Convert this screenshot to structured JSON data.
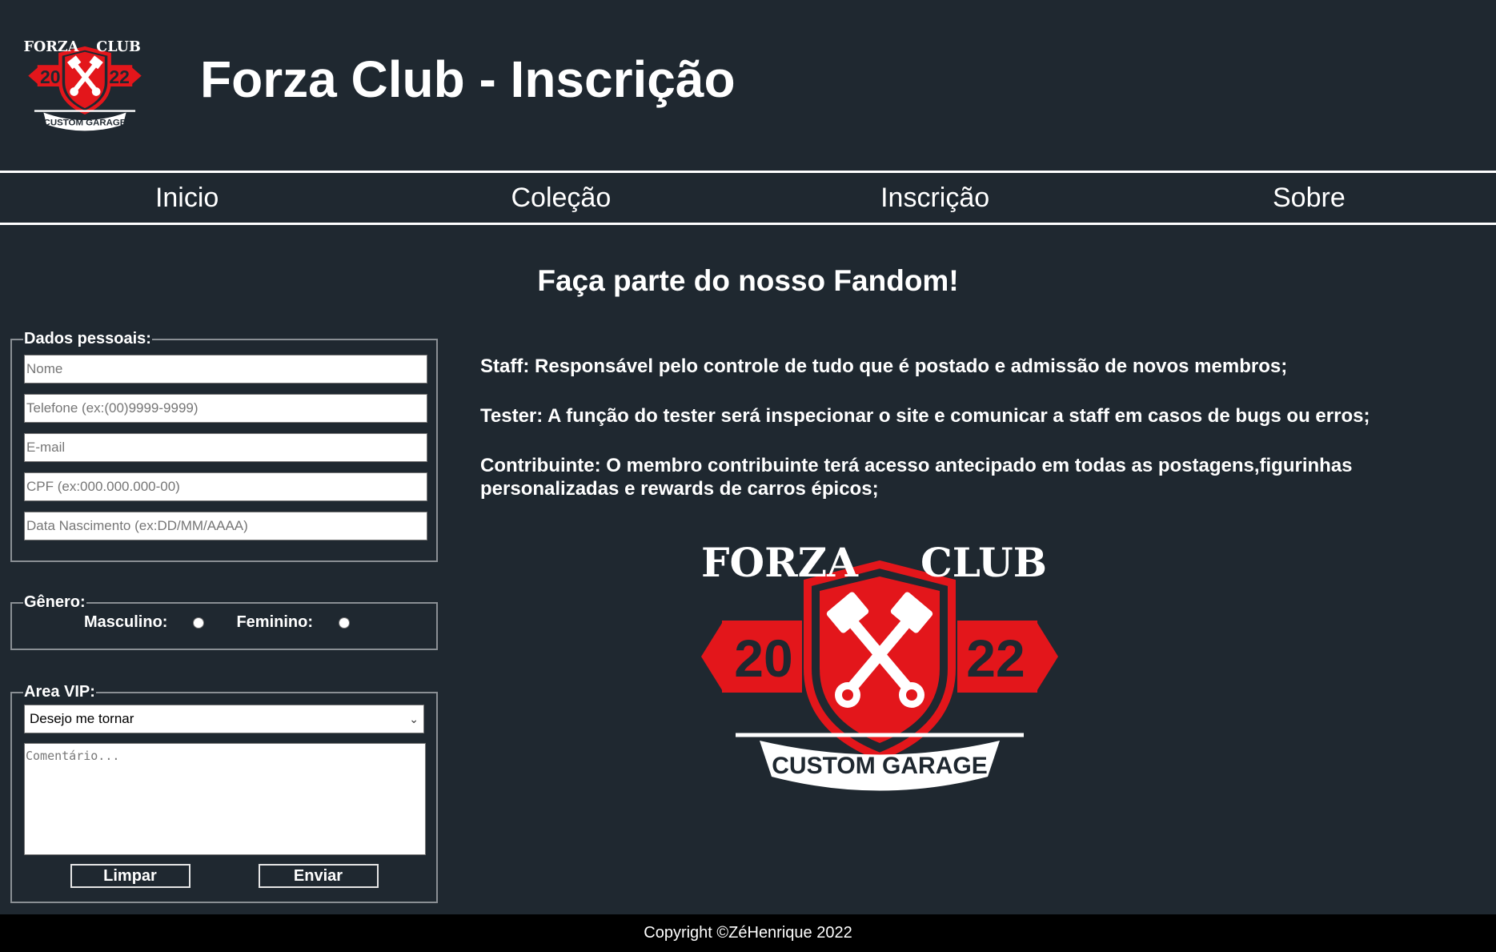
{
  "header": {
    "title": "Forza Club - Inscrição",
    "logo": {
      "top_text_left": "FORZA",
      "top_text_right": "CLUB",
      "year_left": "20",
      "year_right": "22",
      "banner_text": "CUSTOM GARAGE",
      "accent_color": "#e3161b",
      "icon": "crossed-pistons-icon"
    }
  },
  "nav": {
    "items": [
      {
        "label": "Inicio"
      },
      {
        "label": "Coleção"
      },
      {
        "label": "Inscrição"
      },
      {
        "label": "Sobre"
      }
    ]
  },
  "main": {
    "heading": "Faça parte do nosso Fandom!"
  },
  "form": {
    "personal": {
      "legend": "Dados pessoais:",
      "fields": [
        {
          "placeholder": "Nome",
          "value": ""
        },
        {
          "placeholder": "Telefone (ex:(00)9999-9999)",
          "value": ""
        },
        {
          "placeholder": "E-mail",
          "value": ""
        },
        {
          "placeholder": "CPF (ex:000.000.000-00)",
          "value": ""
        },
        {
          "placeholder": "Data Nascimento (ex:DD/MM/AAAA)",
          "value": ""
        }
      ]
    },
    "gender": {
      "legend": "Gênero:",
      "options": [
        {
          "label": "Masculino:",
          "selected": false
        },
        {
          "label": "Feminino:",
          "selected": false
        }
      ]
    },
    "vip": {
      "legend": "Area VIP:",
      "select_value": "Desejo me tornar",
      "comment_placeholder": "Comentário...",
      "clear_label": "Limpar",
      "submit_label": "Enviar"
    }
  },
  "roles": [
    {
      "text": "Staff: Responsável pelo controle de tudo que é postado e admissão de novos membros;"
    },
    {
      "text": "Tester: A função do tester será inspecionar o site e comunicar a staff em casos de bugs ou erros;"
    },
    {
      "text": "Contribuinte: O membro contribuinte terá acesso antecipado em todas as postagens,figurinhas personalizadas e rewards de carros épicos;"
    }
  ],
  "footer": {
    "copyright": "Copyright ©ZéHenrique 2022"
  },
  "colors": {
    "background": "#1f2830",
    "footer": "#000000",
    "text": "#ffffff",
    "accent": "#e3161b"
  }
}
